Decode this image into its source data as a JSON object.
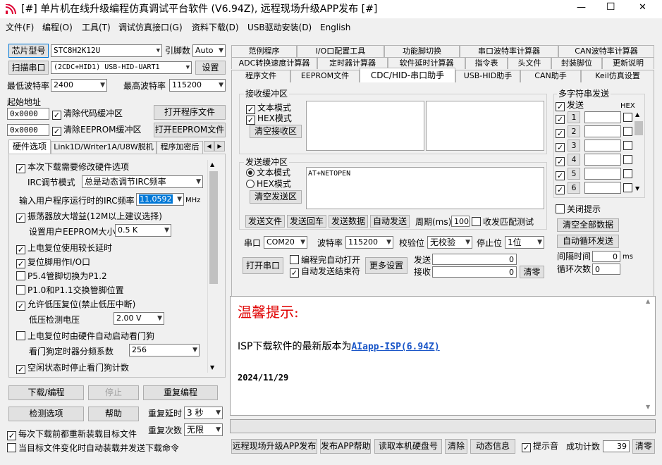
{
  "window": {
    "title": "[#] 单片机在线升级编程仿真调试平台软件 (V6.94Z), 远程现场升级APP发布 [#]",
    "controls": {
      "minimize": "—",
      "maximize": "☐",
      "close": "✕"
    }
  },
  "menu": [
    "文件(F)",
    "编程(O)",
    "工具(T)",
    "调试仿真接口(G)",
    "资料下载(D)",
    "USB驱动安装(D)",
    "English"
  ],
  "left": {
    "chip_button": "芯片型号",
    "chip_value": "STC8H2K12U",
    "pins_label": "引脚数",
    "pins_value": "Auto",
    "scan_button": "扫描串口",
    "port_value": "(2CDC+HID1) USB-HID-UART1",
    "settings_button": "设置",
    "min_baud_label": "最低波特率",
    "min_baud_value": "2400",
    "max_baud_label": "最高波特率",
    "max_baud_value": "115200",
    "start_addr_label": "起始地址",
    "addr1": "0x0000",
    "clear_code": "清除代码缓冲区",
    "open_program": "打开程序文件",
    "addr2": "0x0000",
    "clear_eeprom": "清除EEPROM缓冲区",
    "open_eeprom": "打开EEPROM文件",
    "tabs": [
      "硬件选项",
      "Link1D/Writer1A/U8W脱机",
      "程序加密后"
    ],
    "hw": {
      "need_modify": "本次下载需要修改硬件选项",
      "irc_mode_label": "IRC调节模式",
      "irc_mode_value": "总是动态调节IRC频率",
      "irc_freq_label": "输入用户程序运行时的IRC频率",
      "irc_freq_value": "11.0592",
      "irc_unit": "MHz",
      "osc_amp": "振荡器放大增益(12M以上建议选择)",
      "eeprom_size_label": "设置用户EEPROM大小",
      "eeprom_size_value": "0.5 K",
      "power_reset": "上电复位使用较长延时",
      "reset_io": "复位脚用作I/O口",
      "p54": "P5.4管脚切换为P1.2",
      "p10": "P1.0和P1.1交换管脚位置",
      "low_volt_reset": "允许低压复位(禁止低压中断)",
      "low_volt_label": "低压检测电压",
      "low_volt_value": "2.00 V",
      "wdt_start": "上电复位时由硬件自动启动看门狗",
      "wdt_div_label": "看门狗定时器分频系数",
      "wdt_div_value": "256",
      "wdt_idle": "空闲状态时停止看门狗计数"
    },
    "download_button": "下载/编程",
    "stop_button": "停止",
    "reprogram_button": "重复编程",
    "check_button": "检测选项",
    "help_button": "帮助",
    "repeat_delay_label": "重复延时",
    "repeat_delay_value": "3 秒",
    "repeat_count_label": "重复次数",
    "repeat_count_value": "无限",
    "reload_before": "每次下载前都重新装载目标文件",
    "reload_on_change": "当目标文件变化时自动装载并发送下载命令"
  },
  "right": {
    "tabs_row1": [
      "范例程序",
      "I/O口配置工具",
      "功能脚切换",
      "串口波特率计算器",
      "CAN波特率计算器"
    ],
    "tabs_row2": [
      "ADC转换速度计算器",
      "定时器计算器",
      "软件延时计算器",
      "指令表",
      "头文件",
      "封装脚位",
      "更新说明"
    ],
    "tabs_row3": [
      "程序文件",
      "EEPROM文件",
      "CDC/HID-串口助手",
      "USB-HID助手",
      "CAN助手",
      "Keil仿真设置"
    ],
    "recv_title": "接收缓冲区",
    "text_mode": "文本模式",
    "hex_mode": "HEX模式",
    "clear_recv": "清空接收区",
    "send_title": "发送缓冲区",
    "send_text_mode": "文本模式",
    "send_hex_mode": "HEX模式",
    "clear_send": "清空发送区",
    "send_content": "AT+NETOPEN",
    "send_file": "发送文件",
    "send_back": "发送回车",
    "send_data": "发送数据",
    "auto_send": "自动发送",
    "period_label": "周期(ms)",
    "period_value": "100",
    "match_test": "收发匹配测试",
    "multi_title": "多字符串发送",
    "multi_send": "发送",
    "multi_hex": "HEX",
    "multi_rows": [
      "1",
      "2",
      "3",
      "4",
      "5",
      "6"
    ],
    "close_tip": "关闭提示",
    "clear_all": "清空全部数据",
    "auto_loop": "自动循环发送",
    "interval_label": "间隔时间",
    "interval_value": "0",
    "interval_unit": "ms",
    "loop_count_label": "循环次数",
    "loop_count_value": "0",
    "port_label": "串口",
    "port_value": "COM20",
    "baud_label": "波特率",
    "baud_value": "115200",
    "parity_label": "校验位",
    "parity_value": "无校验",
    "stop_label": "停止位",
    "stop_value": "1位",
    "open_port": "打开串口",
    "auto_open": "编程完自动打开",
    "auto_end": "自动发送结束符",
    "more_settings": "更多设置",
    "send_label": "发送",
    "send_count": "0",
    "recv_label": "接收",
    "recv_count": "0",
    "clear_counts": "清零",
    "tip_title": "温馨提示:",
    "tip_text": "ISP下载软件的最新版本为",
    "tip_link": "AIapp-ISP(6.94Z)",
    "tip_date": "2024/11/29",
    "bottom": {
      "remote_publish": "远程现场升级APP发布",
      "publish_help": "发布APP帮助",
      "read_disk": "读取本机硬盘号",
      "clear": "清除",
      "anim_info": "动态信息",
      "beep": "提示音",
      "success_label": "成功计数",
      "success_value": "39",
      "reset": "清零"
    }
  },
  "colors": {
    "accent": "#1a5fb4",
    "tip_red": "#e00000",
    "link_blue": "#1a56c8",
    "highlight": "#0078d7"
  }
}
